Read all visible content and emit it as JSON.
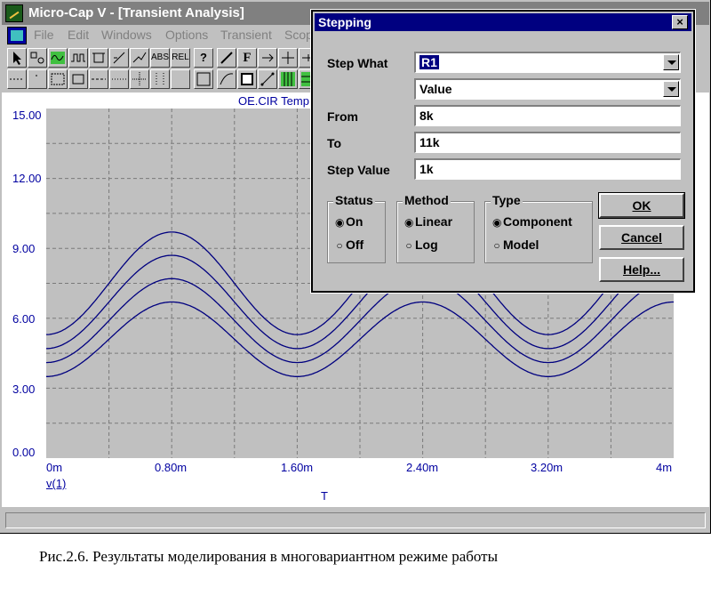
{
  "window": {
    "title": "Micro-Cap V - [Transient Analysis]",
    "menu": [
      "File",
      "Edit",
      "Windows",
      "Options",
      "Transient",
      "Scop"
    ]
  },
  "toolbar": {
    "text_buttons": [
      "ABS",
      "REL",
      "?",
      "F"
    ]
  },
  "plot": {
    "title": "OE.CIR Temp",
    "trace_label": "v(1)",
    "x_axis_label": "T"
  },
  "chart_data": {
    "type": "line",
    "x_ticks": [
      "0m",
      "0.80m",
      "1.60m",
      "2.40m",
      "3.20m",
      "4m"
    ],
    "y_ticks": [
      "15.00",
      "12.00",
      "9.00",
      "6.00",
      "3.00",
      "0.00"
    ],
    "xlim": [
      0,
      4
    ],
    "ylim": [
      0,
      15
    ],
    "x_unit_scale": "ms",
    "grid": true,
    "background": "#c0c0c0",
    "line_color": "#00007f",
    "series": [
      {
        "offset": 7.5,
        "amplitude": 2.2,
        "period": 1.6,
        "phase_peak_x": 0.8
      },
      {
        "offset": 6.7,
        "amplitude": 2.0,
        "period": 1.6,
        "phase_peak_x": 0.8
      },
      {
        "offset": 5.9,
        "amplitude": 1.8,
        "period": 1.6,
        "phase_peak_x": 0.8
      },
      {
        "offset": 5.1,
        "amplitude": 1.6,
        "period": 1.6,
        "phase_peak_x": 0.8
      }
    ]
  },
  "dialog": {
    "title": "Stepping",
    "close_glyph": "×",
    "step_what_label": "Step What",
    "step_what_value": "R1",
    "param_value": "Value",
    "from_label": "From",
    "from_value": "8k",
    "to_label": "To",
    "to_value": "11k",
    "step_value_label": "Step Value",
    "step_value_value": "1k",
    "status": {
      "title": "Status",
      "options": [
        "On",
        "Off"
      ],
      "selected": "On"
    },
    "method": {
      "title": "Method",
      "options": [
        "Linear",
        "Log"
      ],
      "selected": "Linear"
    },
    "type": {
      "title": "Type",
      "options": [
        "Component",
        "Model"
      ],
      "selected": "Component"
    },
    "buttons": {
      "ok": "OK",
      "cancel": "Cancel",
      "help": "Help..."
    }
  },
  "caption": "Рис.2.6. Результаты моделирования в многовариантном режиме работы"
}
